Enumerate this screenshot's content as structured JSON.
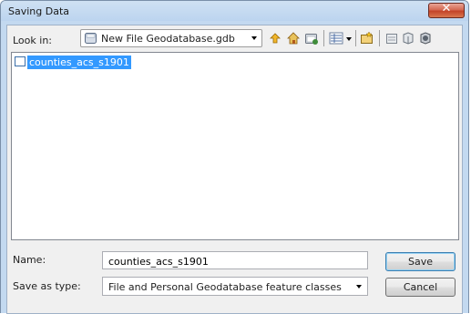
{
  "window": {
    "title": "Saving Data",
    "close_symbol": "✕"
  },
  "lookin": {
    "label": "Look in:",
    "value": "New File Geodatabase.gdb",
    "icon": "geodatabase-icon"
  },
  "toolbar": {
    "icons": [
      "up-one-level-icon",
      "home-icon",
      "connect-folder-icon",
      "view-list-icon",
      "new-feature-class-icon",
      "properties-icon",
      "new-table-icon",
      "globe-icon"
    ]
  },
  "file_list": {
    "items": [
      {
        "label": "counties_acs_s1901",
        "icon": "feature-class-icon",
        "selected": true
      }
    ]
  },
  "name_field": {
    "label": "Name:",
    "value": "counties_acs_s1901"
  },
  "save_type": {
    "label": "Save as type:",
    "value": "File and Personal Geodatabase feature classes"
  },
  "buttons": {
    "save": "Save",
    "cancel": "Cancel"
  },
  "colors": {
    "selection": "#3399ff",
    "title_bar": "#c3d9f0",
    "close_button": "#c34328"
  }
}
